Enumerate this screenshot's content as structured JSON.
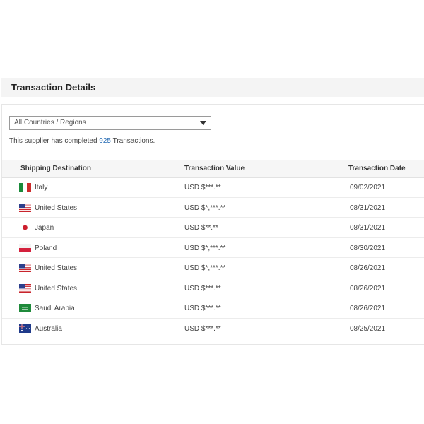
{
  "panel": {
    "title": "Transaction Details"
  },
  "filter": {
    "selected": "All Countries / Regions"
  },
  "summary": {
    "prefix": "This supplier has completed ",
    "count": "925",
    "suffix": " Transactions."
  },
  "table": {
    "headers": {
      "destination": "Shipping Destination",
      "value": "Transaction Value",
      "date": "Transaction Date"
    },
    "rows": [
      {
        "flag": "italy-flag-icon",
        "destination": "Italy",
        "value": "USD $***.**",
        "date": "09/02/2021"
      },
      {
        "flag": "usa-flag-icon",
        "destination": "United States",
        "value": "USD $*,***.**",
        "date": "08/31/2021"
      },
      {
        "flag": "japan-flag-icon",
        "destination": "Japan",
        "value": "USD $**.**",
        "date": "08/31/2021"
      },
      {
        "flag": "poland-flag-icon",
        "destination": "Poland",
        "value": "USD $*,***.**",
        "date": "08/30/2021"
      },
      {
        "flag": "usa-flag-icon",
        "destination": "United States",
        "value": "USD $*,***.**",
        "date": "08/26/2021"
      },
      {
        "flag": "usa-flag-icon",
        "destination": "United States",
        "value": "USD $***.**",
        "date": "08/26/2021"
      },
      {
        "flag": "saudi-arabia-flag-icon",
        "destination": "Saudi Arabia",
        "value": "USD $***.**",
        "date": "08/26/2021"
      },
      {
        "flag": "australia-flag-icon",
        "destination": "Australia",
        "value": "USD $***.**",
        "date": "08/25/2021"
      }
    ]
  }
}
